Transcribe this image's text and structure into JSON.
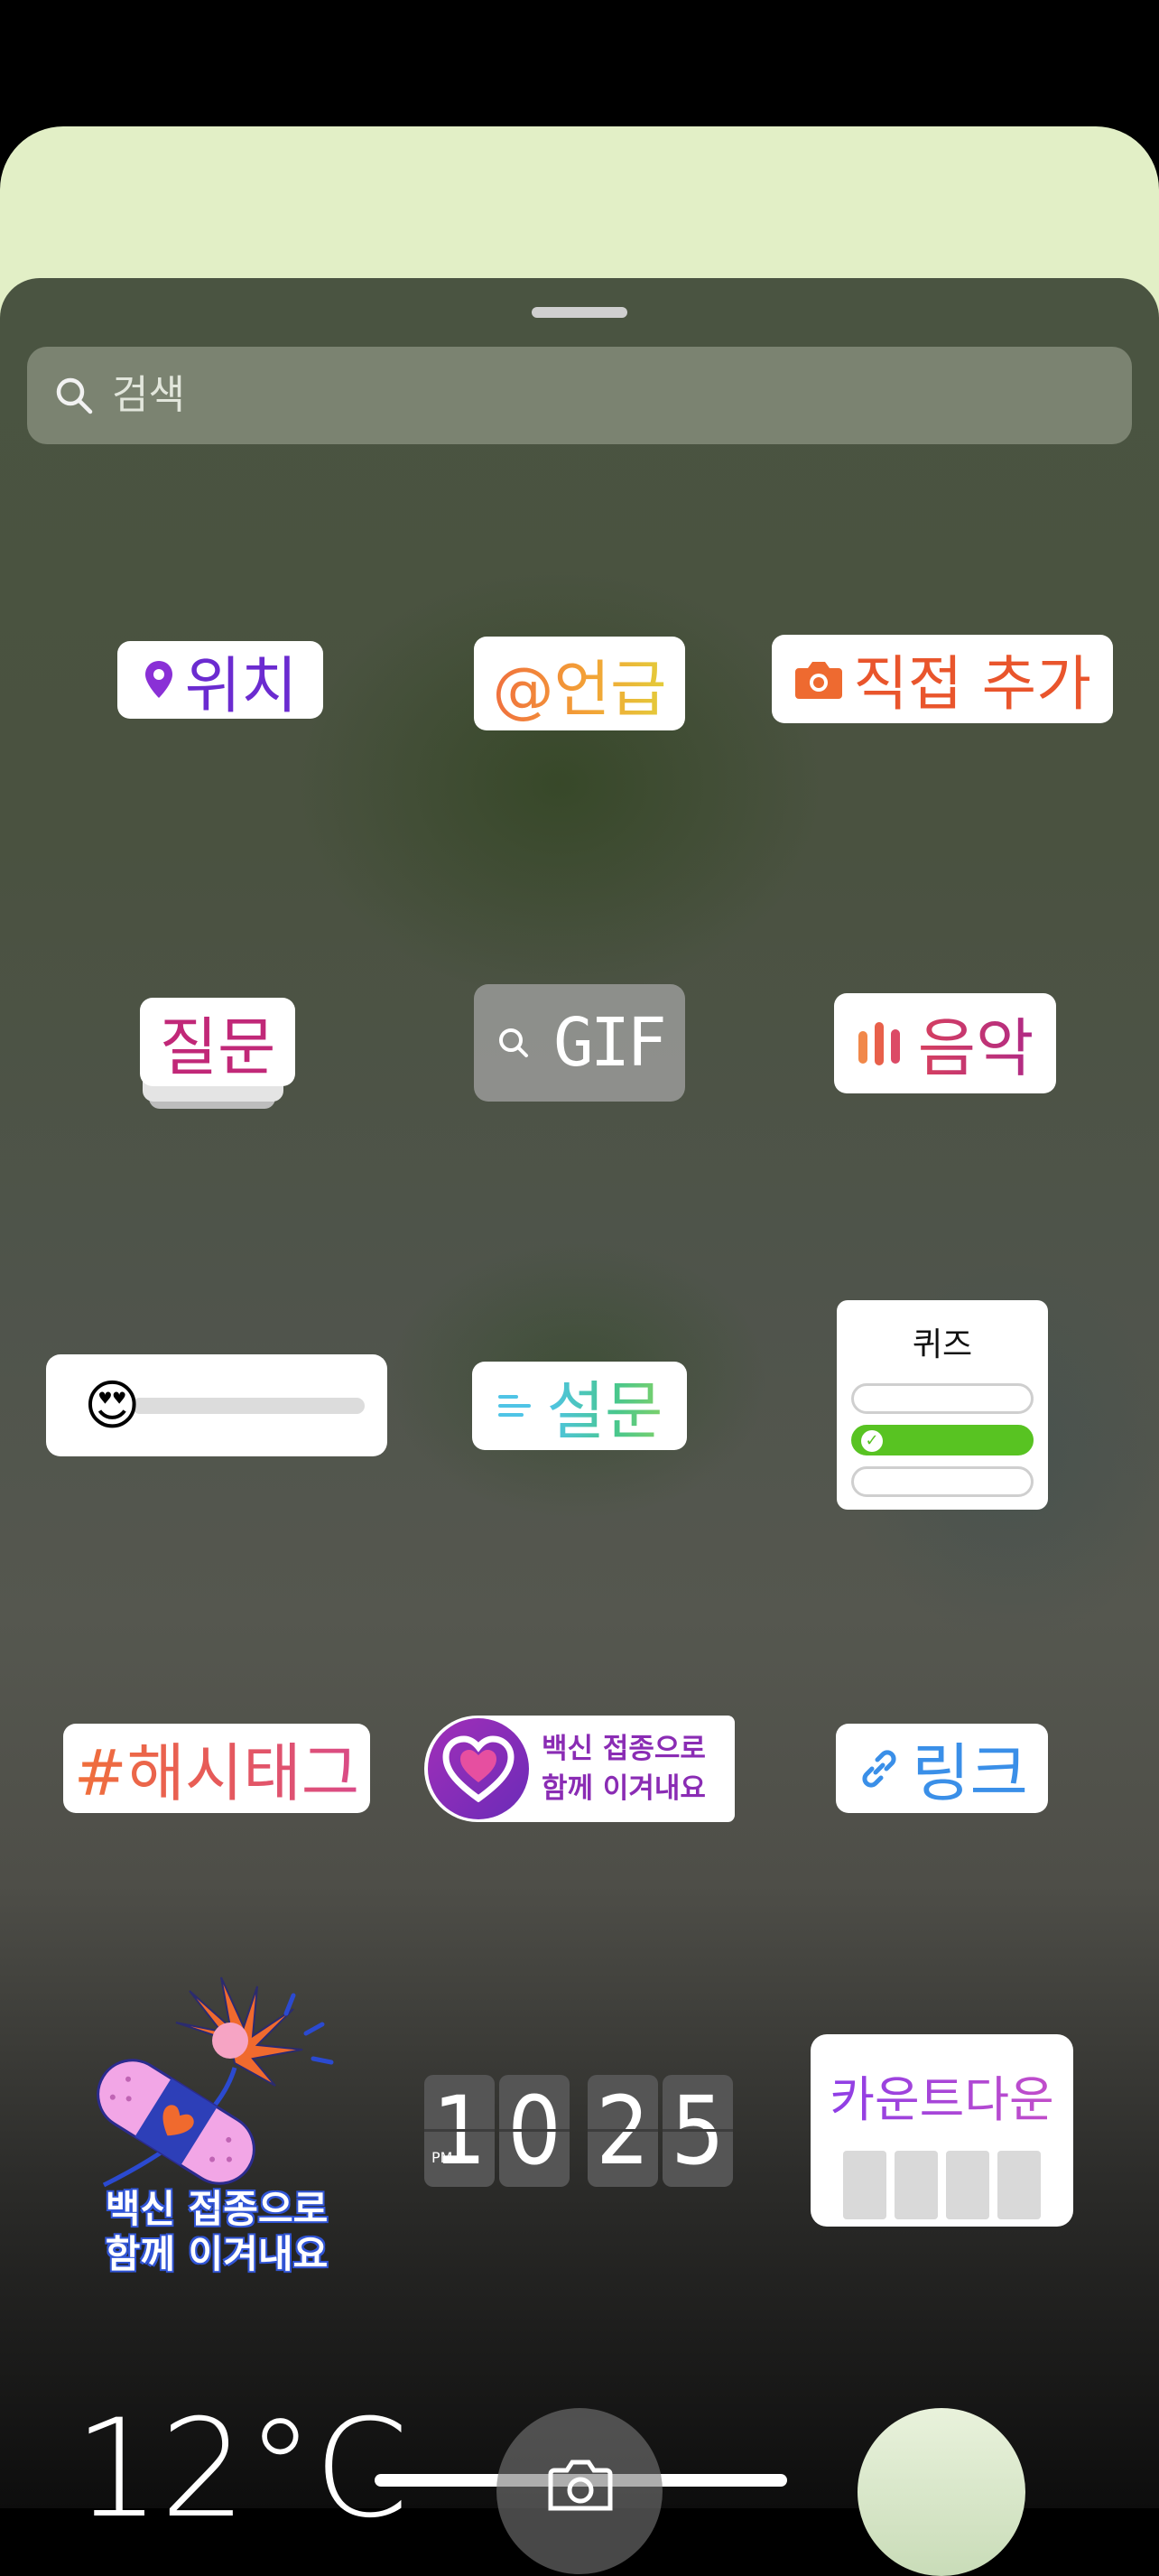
{
  "search": {
    "placeholder": "검색"
  },
  "stickers": {
    "location": "위치",
    "mention": "@언급",
    "add_yours": "직접 추가",
    "question": "질문",
    "gif": "GIF",
    "music": "음악",
    "slider_emoji": "😍",
    "poll": "설문",
    "quiz": "퀴즈",
    "hashtag": "#해시태그",
    "vaccine_line1": "백신 접종으로",
    "vaccine_line2": "함께 이겨내요",
    "link": "링크",
    "bandage_line1": "백신 접종으로",
    "bandage_line2": "함께 이겨내요",
    "clock": {
      "ampm": "PM",
      "h1": "1",
      "h2": "0",
      "m1": "2",
      "m2": "5"
    },
    "countdown": "카운트다운"
  },
  "bottom": {
    "temperature": "12°C"
  },
  "colors": {
    "sheet_top": "#4a5441",
    "top_card": "#e2efc6",
    "location": "#6b2bd0",
    "add_yours": "#e9552c",
    "link": "#3a8fe8",
    "quiz_correct": "#58c322"
  },
  "icons": [
    "search-icon",
    "location-pin-icon",
    "camera-icon",
    "gif-search-icon",
    "music-bars-icon",
    "poll-lines-icon",
    "check-icon",
    "link-icon",
    "heart-badge-icon",
    "capture-camera-icon"
  ]
}
